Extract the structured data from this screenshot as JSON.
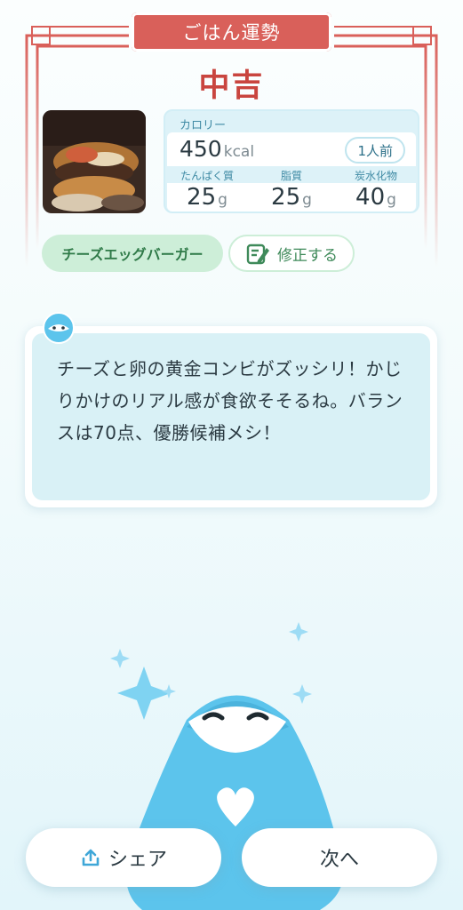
{
  "header": {
    "banner_title": "ごはん運勢",
    "fortune": "中吉"
  },
  "nutrition": {
    "calorie_label": "カロリー",
    "calorie_value": "450",
    "calorie_unit": "kcal",
    "serving": "1人前",
    "macros": [
      {
        "label": "たんぱく質",
        "value": "25",
        "unit": "g"
      },
      {
        "label": "脂質",
        "value": "25",
        "unit": "g"
      },
      {
        "label": "炭水化物",
        "value": "40",
        "unit": "g"
      }
    ]
  },
  "food": {
    "name": "チーズエッグバーガー",
    "edit_label": "修正する"
  },
  "message": {
    "text": "チーズと卵の黄金コンビがズッシリ！かじりかけのリアル感が食欲そそるね。バランスは70点、優勝候補メシ！"
  },
  "actions": {
    "share_label": "シェア",
    "next_label": "次へ"
  },
  "colors": {
    "accent_red": "#d9605a",
    "fortune_red": "#c9453f",
    "mascot_blue": "#5cc4ec",
    "chip_green": "#cdeed8"
  }
}
